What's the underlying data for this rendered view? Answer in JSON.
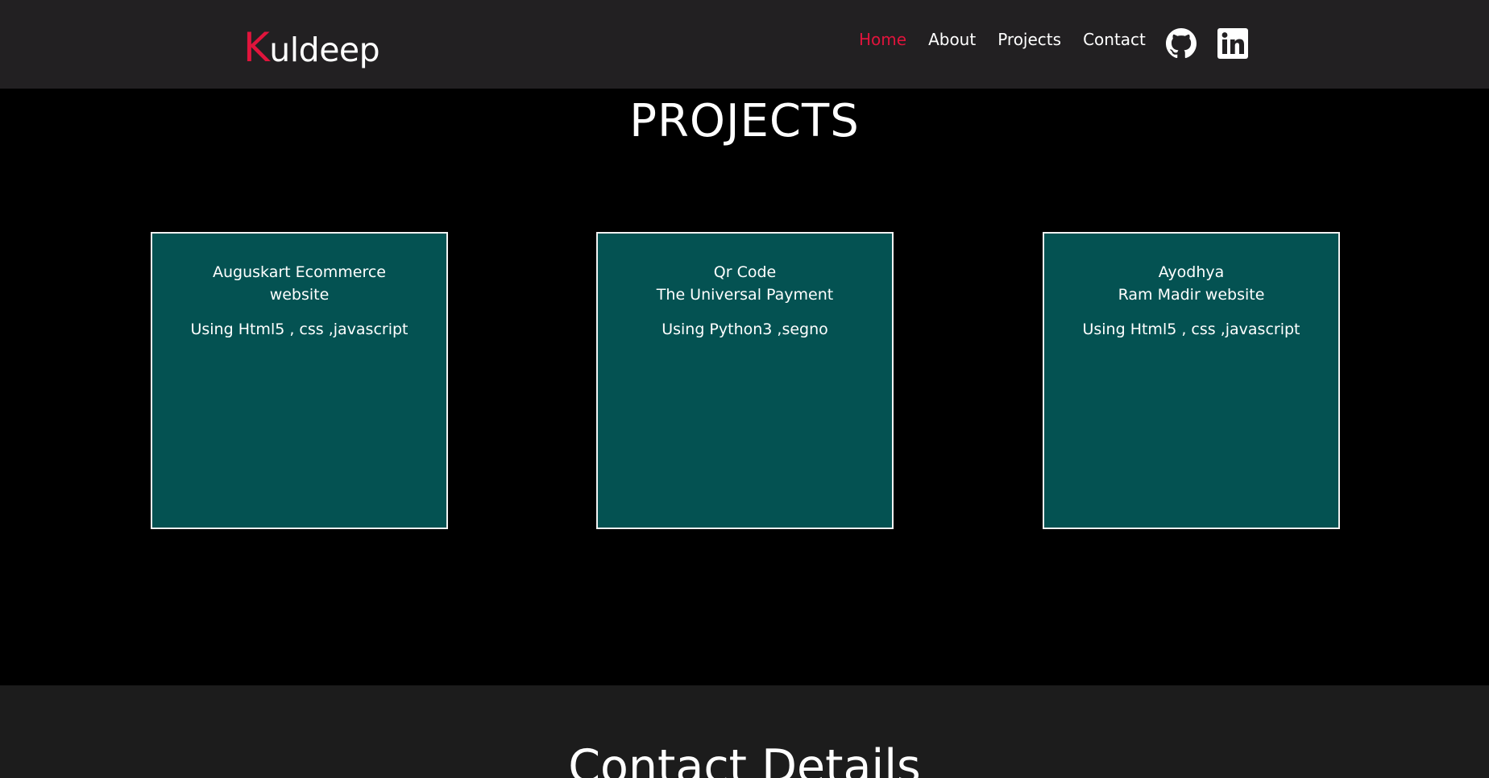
{
  "header": {
    "logo_first": "K",
    "logo_rest": "uldeep",
    "nav": [
      {
        "label": "Home"
      },
      {
        "label": "About"
      },
      {
        "label": "Projects"
      },
      {
        "label": "Contact"
      }
    ],
    "social_icons": [
      "github-icon",
      "linkedin-icon"
    ]
  },
  "projects": {
    "heading": "PROJECTS",
    "cards": [
      {
        "title_line1": "Auguskart Ecommerce",
        "title_line2": "website",
        "tech": "Using Html5 , css ,javascript"
      },
      {
        "title_line1": "Qr Code",
        "title_line2": "The Universal Payment",
        "tech": "Using Python3 ,segno"
      },
      {
        "title_line1": "Ayodhya",
        "title_line2": "Ram Madir website",
        "tech": "Using Html5 , css ,javascript"
      }
    ]
  },
  "contact": {
    "heading": "Contact Details"
  },
  "colors": {
    "accent": "#e0143c",
    "navbar_bg": "#222022",
    "card_bg": "#045252",
    "page_bg": "#000000",
    "contact_bg": "#1c1c1c"
  }
}
